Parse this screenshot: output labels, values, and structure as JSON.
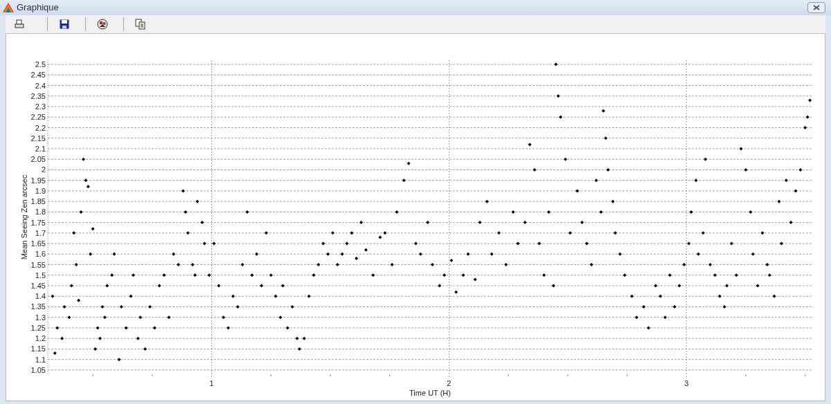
{
  "window": {
    "title": "Graphique"
  },
  "chart": {
    "chart_data": {
      "type": "scatter",
      "grid": true,
      "xlabel": "Time UT (H)",
      "ylabel": "Mean Seeing Zen arcsec",
      "xlim": [
        0.31,
        3.53
      ],
      "ylim": [
        1.03,
        2.52
      ],
      "xticks": [
        1,
        2,
        3
      ],
      "yticks": [
        1.05,
        1.1,
        1.15,
        1.2,
        1.25,
        1.3,
        1.35,
        1.4,
        1.45,
        1.5,
        1.55,
        1.6,
        1.65,
        1.7,
        1.75,
        1.8,
        1.85,
        1.9,
        1.95,
        2,
        2.05,
        2.1,
        2.15,
        2.2,
        2.25,
        2.3,
        2.35,
        2.4,
        2.45,
        2.5
      ],
      "x": [
        0.33,
        0.34,
        0.35,
        0.37,
        0.38,
        0.4,
        0.41,
        0.42,
        0.43,
        0.44,
        0.45,
        0.46,
        0.47,
        0.48,
        0.49,
        0.5,
        0.51,
        0.52,
        0.53,
        0.54,
        0.55,
        0.56,
        0.58,
        0.59,
        0.61,
        0.62,
        0.64,
        0.66,
        0.67,
        0.69,
        0.7,
        0.72,
        0.74,
        0.76,
        0.78,
        0.8,
        0.82,
        0.84,
        0.86,
        0.88,
        0.89,
        0.9,
        0.92,
        0.93,
        0.94,
        0.96,
        0.97,
        0.99,
        1.01,
        1.03,
        1.05,
        1.07,
        1.09,
        1.11,
        1.13,
        1.15,
        1.17,
        1.19,
        1.21,
        1.23,
        1.25,
        1.27,
        1.29,
        1.3,
        1.32,
        1.34,
        1.36,
        1.37,
        1.39,
        1.41,
        1.43,
        1.45,
        1.47,
        1.49,
        1.51,
        1.53,
        1.55,
        1.57,
        1.59,
        1.61,
        1.63,
        1.65,
        1.68,
        1.71,
        1.73,
        1.76,
        1.78,
        1.81,
        1.83,
        1.86,
        1.88,
        1.91,
        1.93,
        1.96,
        1.98,
        2.01,
        2.03,
        2.06,
        2.08,
        2.11,
        2.13,
        2.16,
        2.18,
        2.21,
        2.24,
        2.27,
        2.29,
        2.32,
        2.34,
        2.36,
        2.38,
        2.4,
        2.42,
        2.44,
        2.45,
        2.46,
        2.47,
        2.49,
        2.51,
        2.54,
        2.56,
        2.58,
        2.6,
        2.62,
        2.64,
        2.65,
        2.66,
        2.67,
        2.69,
        2.7,
        2.72,
        2.74,
        2.77,
        2.79,
        2.82,
        2.84,
        2.87,
        2.89,
        2.91,
        2.93,
        2.95,
        2.97,
        2.99,
        3.01,
        3.02,
        3.04,
        3.05,
        3.07,
        3.08,
        3.1,
        3.12,
        3.14,
        3.16,
        3.17,
        3.19,
        3.21,
        3.23,
        3.25,
        3.27,
        3.28,
        3.3,
        3.32,
        3.34,
        3.35,
        3.37,
        3.39,
        3.4,
        3.42,
        3.44,
        3.46,
        3.48,
        3.5,
        3.51,
        3.52
      ],
      "series": [
        {
          "color": "#000000",
          "values": [
            1.4,
            1.13,
            1.25,
            1.2,
            1.35,
            1.3,
            1.45,
            1.7,
            1.55,
            1.38,
            1.8,
            2.05,
            1.95,
            1.92,
            1.6,
            1.72,
            1.15,
            1.25,
            1.2,
            1.35,
            1.3,
            1.45,
            1.5,
            1.6,
            1.1,
            1.35,
            1.25,
            1.4,
            1.5,
            1.2,
            1.3,
            1.15,
            1.35,
            1.25,
            1.45,
            1.5,
            1.3,
            1.6,
            1.55,
            1.9,
            1.8,
            1.7,
            1.55,
            1.5,
            1.85,
            1.75,
            1.65,
            1.5,
            1.65,
            1.45,
            1.3,
            1.25,
            1.4,
            1.35,
            1.55,
            1.8,
            1.5,
            1.6,
            1.45,
            1.7,
            1.5,
            1.4,
            1.3,
            1.45,
            1.25,
            1.35,
            1.2,
            1.15,
            1.2,
            1.4,
            1.5,
            1.55,
            1.65,
            1.6,
            1.7,
            1.55,
            1.6,
            1.65,
            1.7,
            1.58,
            1.75,
            1.62,
            1.5,
            1.68,
            1.7,
            1.55,
            1.8,
            1.95,
            2.03,
            1.65,
            1.6,
            1.75,
            1.55,
            1.45,
            1.5,
            1.57,
            1.42,
            1.5,
            1.6,
            1.48,
            1.75,
            1.85,
            1.6,
            1.7,
            1.55,
            1.8,
            1.65,
            1.75,
            2.12,
            2.0,
            1.65,
            1.5,
            1.8,
            1.45,
            2.5,
            2.35,
            2.25,
            2.05,
            1.7,
            1.9,
            1.75,
            1.65,
            1.55,
            1.95,
            1.8,
            2.28,
            2.15,
            2.0,
            1.85,
            1.7,
            1.6,
            1.5,
            1.4,
            1.3,
            1.35,
            1.25,
            1.45,
            1.4,
            1.3,
            1.5,
            1.35,
            1.45,
            1.55,
            1.65,
            1.8,
            1.95,
            1.6,
            1.7,
            2.05,
            1.55,
            1.5,
            1.4,
            1.35,
            1.45,
            1.65,
            1.5,
            2.1,
            2.0,
            1.8,
            1.6,
            1.45,
            1.7,
            1.55,
            1.5,
            1.4,
            1.85,
            1.65,
            1.95,
            1.75,
            1.9,
            2.0,
            2.2,
            2.25,
            2.33
          ]
        }
      ]
    }
  }
}
